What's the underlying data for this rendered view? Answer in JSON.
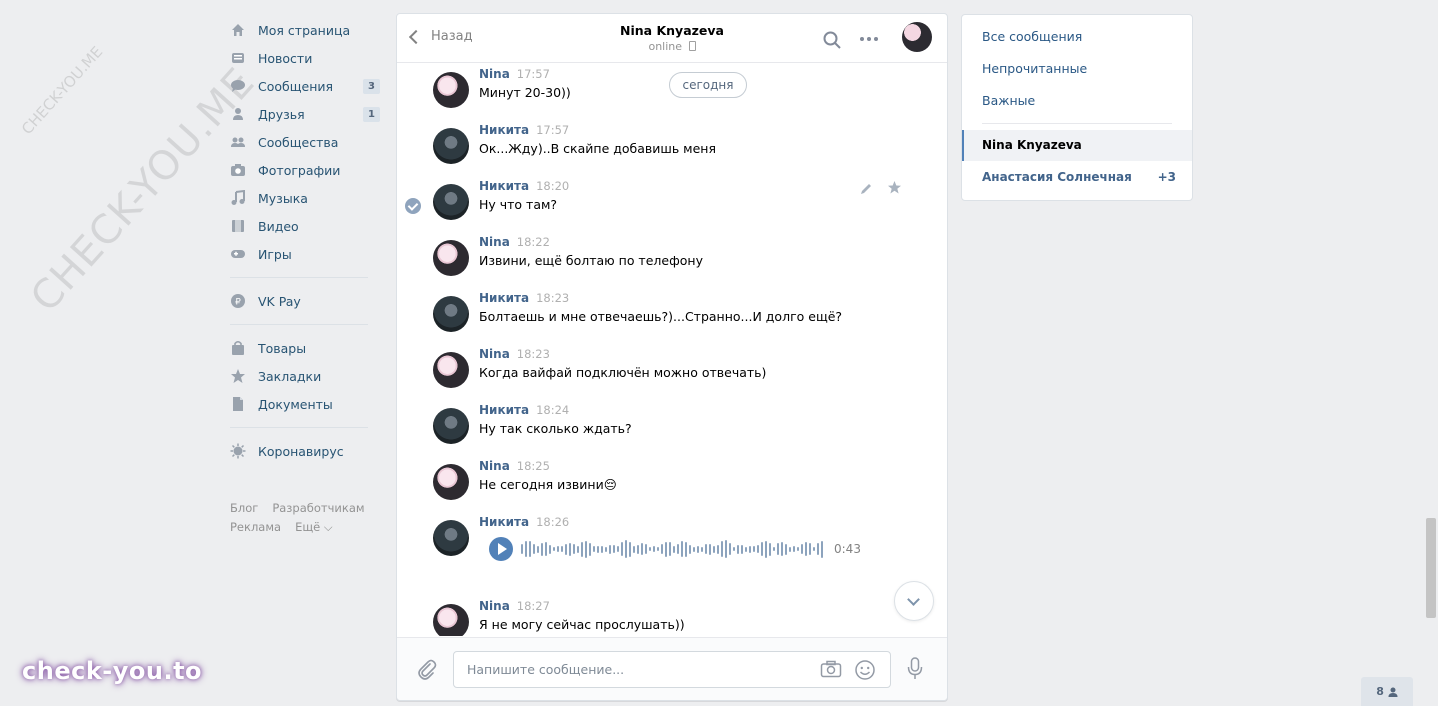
{
  "nav": {
    "items": [
      {
        "label": "Моя страница",
        "icon": "home-icon"
      },
      {
        "label": "Новости",
        "icon": "news-icon"
      },
      {
        "label": "Сообщения",
        "icon": "messages-icon",
        "count": "3"
      },
      {
        "label": "Друзья",
        "icon": "friends-icon",
        "count": "1"
      },
      {
        "label": "Сообщества",
        "icon": "communities-icon"
      },
      {
        "label": "Фотографии",
        "icon": "camera-icon"
      },
      {
        "label": "Музыка",
        "icon": "music-icon"
      },
      {
        "label": "Видео",
        "icon": "video-icon"
      },
      {
        "label": "Игры",
        "icon": "gamepad-icon"
      }
    ],
    "vkpay": "VK Pay",
    "items2": [
      {
        "label": "Товары",
        "icon": "bag-icon"
      },
      {
        "label": "Закладки",
        "icon": "star-icon"
      },
      {
        "label": "Документы",
        "icon": "document-icon"
      }
    ],
    "covid": "Коронавирус",
    "footer": {
      "blog": "Блог",
      "devs": "Разработчикам",
      "ads": "Реклама",
      "more": "Ещё ⌵"
    }
  },
  "chat": {
    "back_label": "Назад",
    "peer_name": "Nina Knyazeva",
    "peer_status": "online",
    "date_pill": "сегодня",
    "messages": [
      {
        "author": "Nina",
        "time": "17:57",
        "text": "Минут 20-30))"
      },
      {
        "author": "Никита",
        "time": "17:57",
        "text": "Ок...Жду)..В скайпе добавишь меня"
      },
      {
        "author": "Никита",
        "time": "18:20",
        "text": "Ну что там?"
      },
      {
        "author": "Nina",
        "time": "18:22",
        "text": "Извини, ещё болтаю по телефону"
      },
      {
        "author": "Никита",
        "time": "18:23",
        "text": "Болтаешь и мне отвечаешь?)...Странно...И долго ещё?"
      },
      {
        "author": "Nina",
        "time": "18:23",
        "text": "Когда вайфай подключён можно отвечать)"
      },
      {
        "author": "Никита",
        "time": "18:24",
        "text": "Ну так сколько ждать?"
      },
      {
        "author": "Nina",
        "time": "18:25",
        "text": "Не сегодня извини😔"
      },
      {
        "author": "Никита",
        "time": "18:26",
        "text": ""
      },
      {
        "author": "Nina",
        "time": "18:27",
        "text": "Я не могу сейчас прослушать))"
      }
    ],
    "voice_duration": "0:43",
    "composer_placeholder": "Напишите сообщение..."
  },
  "right_panel": {
    "all": "Все сообщения",
    "unread": "Непрочитанные",
    "important": "Важные",
    "active_conv": "Nina Knyazeva",
    "conv2": "Анастасия Солнечная",
    "conv2_count": "+3"
  },
  "online_count": "8",
  "watermark_big": "CHECK-YOU.ME",
  "watermark_small": "CHECK-YOU.ME",
  "brand": "check-you.to"
}
